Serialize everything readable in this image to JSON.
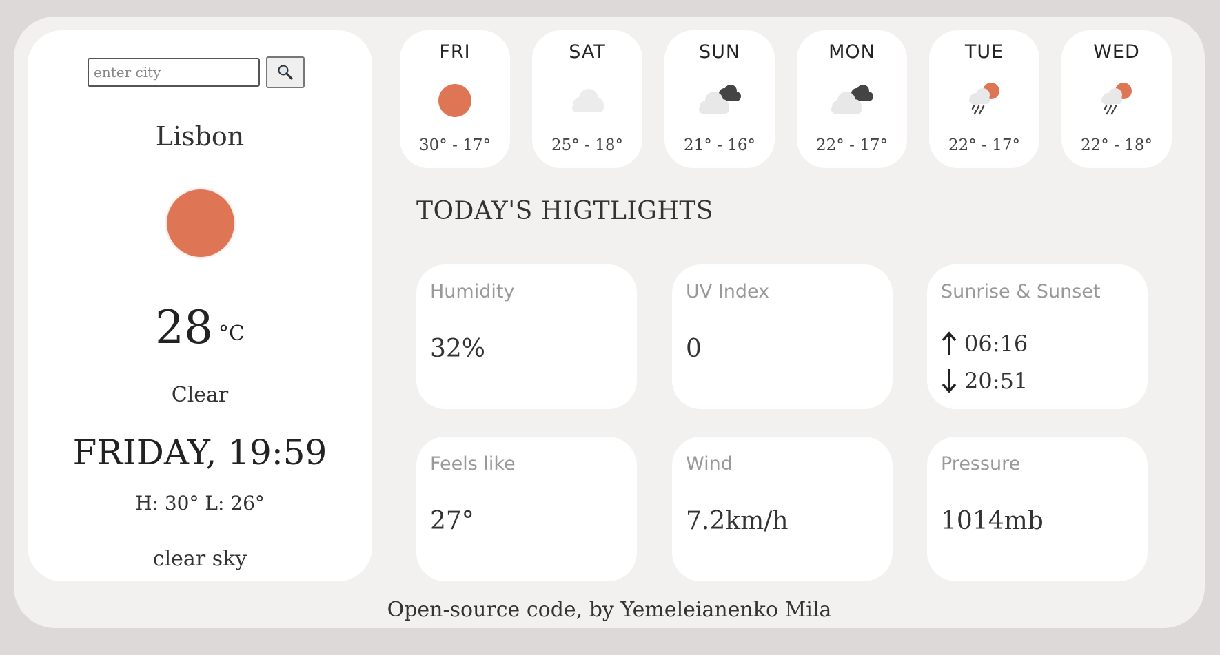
{
  "search": {
    "placeholder": "enter city",
    "button_icon": "search-icon"
  },
  "current": {
    "city": "Lisbon",
    "icon": "sun-icon",
    "temperature": "28",
    "unit": "°C",
    "condition": "Clear",
    "day_time": "FRIDAY, 19:59",
    "high_low": "H: 30° L: 26°",
    "description": "clear sky"
  },
  "forecast": [
    {
      "day": "FRI",
      "icon": "sun-icon",
      "temps": "30° - 17°"
    },
    {
      "day": "SAT",
      "icon": "cloud-icon",
      "temps": "25° - 18°"
    },
    {
      "day": "SUN",
      "icon": "broken-clouds-icon",
      "temps": "21° - 16°"
    },
    {
      "day": "MON",
      "icon": "broken-clouds-icon",
      "temps": "22° - 17°"
    },
    {
      "day": "TUE",
      "icon": "sun-rain-icon",
      "temps": "22° - 17°"
    },
    {
      "day": "WED",
      "icon": "sun-rain-icon",
      "temps": "22° - 18°"
    }
  ],
  "highlights": {
    "title": "TODAY'S HIGTLIGHTS",
    "humidity": {
      "label": "Humidity",
      "value": "32%"
    },
    "uv": {
      "label": "UV Index",
      "value": "0"
    },
    "sun": {
      "label": "Sunrise & Sunset",
      "sunrise": "06:16",
      "sunset": "20:51"
    },
    "feels_like": {
      "label": "Feels like",
      "value": "27°"
    },
    "wind": {
      "label": "Wind",
      "value": "7.2km/h"
    },
    "pressure": {
      "label": "Pressure",
      "value": "1014mb"
    }
  },
  "footer": "Open-source code, by Yemeleianenko Mila",
  "colors": {
    "accent": "#de7656",
    "background": "#dcd9d8",
    "panel": "#f2f1ef",
    "card": "#ffffff"
  }
}
